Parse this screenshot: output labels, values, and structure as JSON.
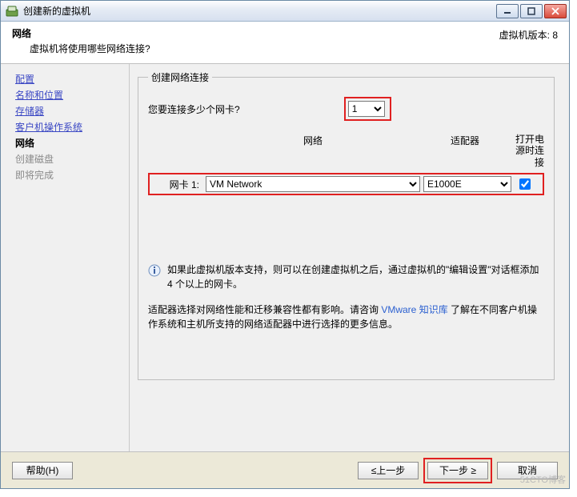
{
  "titlebar": {
    "title": "创建新的虚拟机"
  },
  "header": {
    "title": "网络",
    "subtitle": "虚拟机将使用哪些网络连接?",
    "version": "虚拟机版本: 8"
  },
  "sidebar": {
    "items": [
      {
        "label": "配置",
        "state": "done"
      },
      {
        "label": "名称和位置",
        "state": "done"
      },
      {
        "label": "存储器",
        "state": "done"
      },
      {
        "label": "客户机操作系统",
        "state": "done"
      },
      {
        "label": "网络",
        "state": "current"
      },
      {
        "label": "创建磁盘",
        "state": "pending"
      },
      {
        "label": "即将完成",
        "state": "pending"
      }
    ]
  },
  "content": {
    "group_legend": "创建网络连接",
    "question": "您要连接多少个网卡?",
    "nic_count": "1",
    "cols": {
      "network": "网络",
      "adapter": "适配器",
      "power": "打开电源时连接"
    },
    "nic1": {
      "label": "网卡 1:",
      "network": "VM Network",
      "adapter": "E1000E",
      "checked": true
    },
    "info_text": "如果此虚拟机版本支持，则可以在创建虚拟机之后，通过虚拟机的\"编辑设置\"对话框添加 4 个以上的网卡。",
    "note_pre": "适配器选择对网络性能和迁移兼容性都有影响。请咨询 ",
    "note_link": "VMware 知识库",
    "note_post": " 了解在不同客户机操作系统和主机所支持的网络适配器中进行选择的更多信息。"
  },
  "footer": {
    "help": "帮助(H)",
    "back": "≤上一步",
    "next": "下一步 ≥",
    "cancel": "取消"
  },
  "watermark": "51CTO博客"
}
